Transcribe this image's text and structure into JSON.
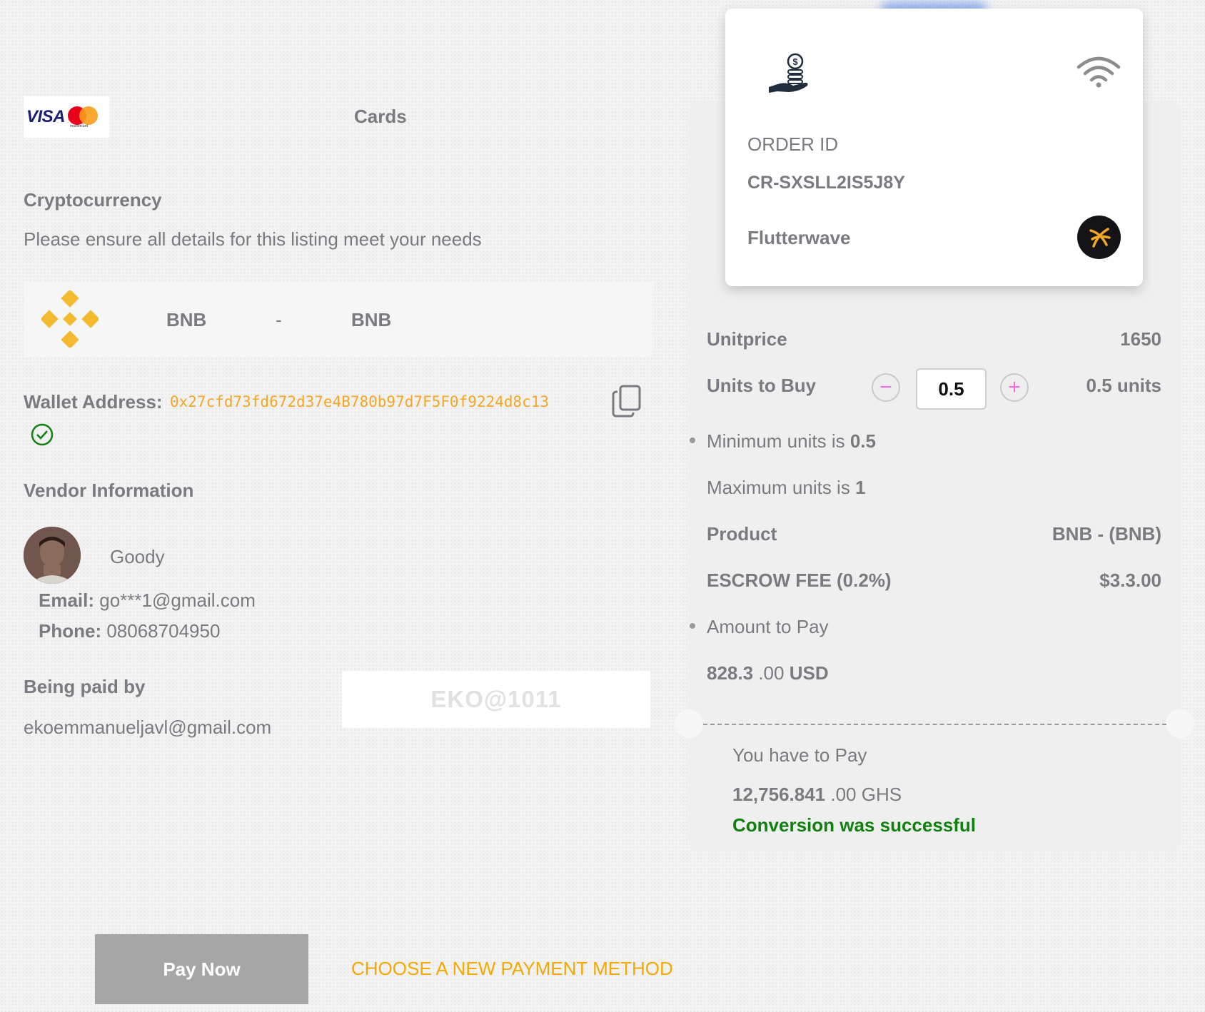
{
  "payment_methods": {
    "cards_label": "Cards",
    "visa_text": "VISA",
    "mastercard_text": "mastercard"
  },
  "crypto": {
    "title": "Cryptocurrency",
    "subtitle": "Please ensure all details for this listing meet your needs",
    "asset_name": "BNB",
    "separator": "-",
    "asset_code": "BNB",
    "accent_color": "#F3BA2F"
  },
  "wallet": {
    "label": "Wallet Address:",
    "address": "0x27cfd73fd672d37e4B780b97d7F5F0f9224d8c13"
  },
  "vendor": {
    "title": "Vendor Information",
    "name": "Goody",
    "email_label": "Email:",
    "email": "go***1@gmail.com",
    "phone_label": "Phone:",
    "phone": "08068704950"
  },
  "payer": {
    "title": "Being paid by",
    "email": "ekoemmanueljavl@gmail.com",
    "code": "EKO@1011"
  },
  "actions": {
    "pay_now": "Pay Now",
    "choose_method": "CHOOSE A NEW PAYMENT METHOD"
  },
  "order": {
    "id_label": "ORDER ID",
    "id_value": "CR-SXSLL2IS5J8Y",
    "provider": "Flutterwave"
  },
  "summary": {
    "unitprice_label": "Unitprice",
    "unitprice_value": "1650",
    "units_label": "Units to Buy",
    "units_input": "0.5",
    "units_value": "0.5 units",
    "stepper_minus": "−",
    "stepper_plus": "+",
    "min_units_text": "Minimum units is ",
    "min_units_value": "0.5",
    "max_units_text": "Maximum units is ",
    "max_units_value": "1",
    "product_label": "Product",
    "product_value": "BNB - (BNB)",
    "fee_label": "ESCROW FEE (0.2%)",
    "fee_value": "$3.3.00",
    "amount_label": "Amount to Pay",
    "amount_main": "828.3",
    "amount_decimals": ".00",
    "amount_currency": "USD"
  },
  "final": {
    "label": "You have to Pay",
    "amount_main": "12,756.841",
    "amount_rest": ".00 GHS",
    "status": "Conversion was successful",
    "status_color": "#118011"
  },
  "icons": {
    "copy": "copy-icon",
    "check": "check-circle-icon",
    "coins": "coins-hand-icon",
    "wifi": "wifi-icon",
    "flutterwave": "flutterwave-logo"
  }
}
